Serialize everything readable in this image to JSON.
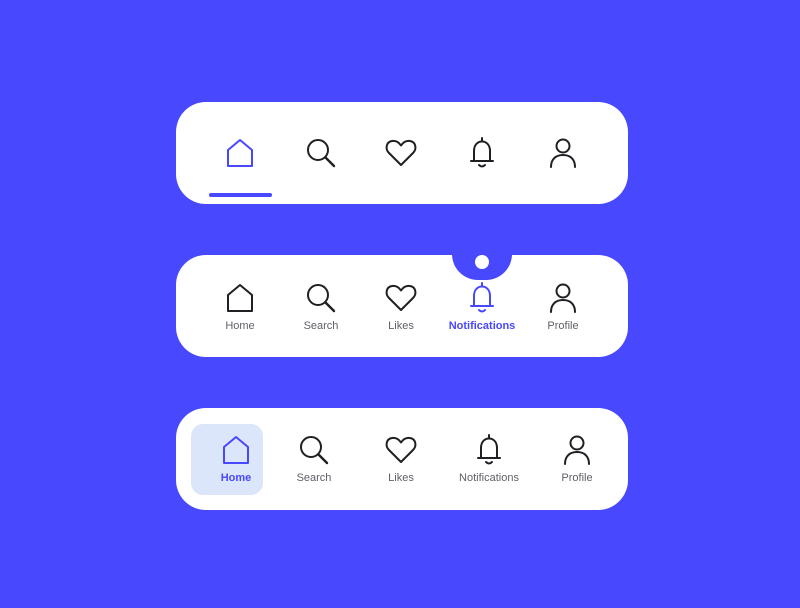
{
  "colors": {
    "background": "#4848FF",
    "accent": "#4848FF",
    "card": "#FFFFFF",
    "highlight": "#DCE6FB"
  },
  "nav_bar_1": {
    "items": [
      {
        "icon": "home-icon",
        "active": true
      },
      {
        "icon": "search-icon"
      },
      {
        "icon": "heart-icon"
      },
      {
        "icon": "bell-icon"
      },
      {
        "icon": "user-icon"
      }
    ]
  },
  "nav_bar_2": {
    "items": [
      {
        "icon": "home-icon",
        "label": "Home"
      },
      {
        "icon": "search-icon",
        "label": "Search"
      },
      {
        "icon": "heart-icon",
        "label": "Likes"
      },
      {
        "icon": "bell-icon",
        "label": "Notifications",
        "active": true
      },
      {
        "icon": "user-icon",
        "label": "Profile"
      }
    ]
  },
  "nav_bar_3": {
    "items": [
      {
        "icon": "home-icon",
        "label": "Home",
        "active": true
      },
      {
        "icon": "search-icon",
        "label": "Search"
      },
      {
        "icon": "heart-icon",
        "label": "Likes"
      },
      {
        "icon": "bell-icon",
        "label": "Notifications"
      },
      {
        "icon": "user-icon",
        "label": "Profile"
      }
    ]
  }
}
